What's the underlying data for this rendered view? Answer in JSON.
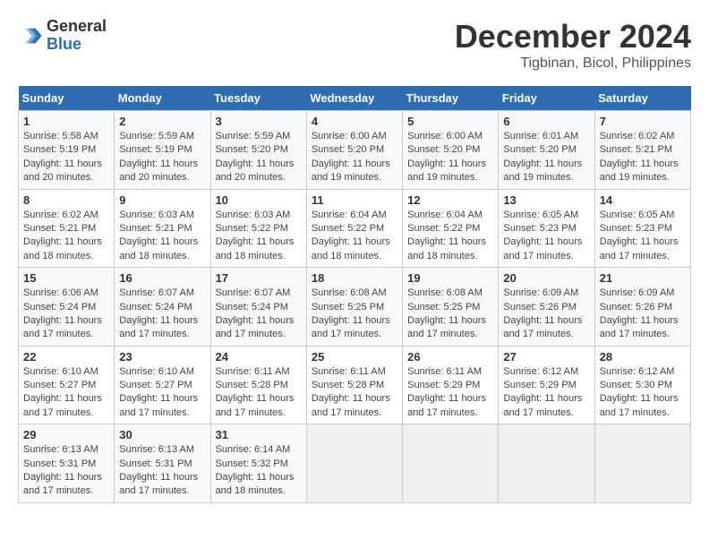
{
  "header": {
    "logo_general": "General",
    "logo_blue": "Blue",
    "title": "December 2024",
    "subtitle": "Tigbinan, Bicol, Philippines"
  },
  "calendar": {
    "days_of_week": [
      "Sunday",
      "Monday",
      "Tuesday",
      "Wednesday",
      "Thursday",
      "Friday",
      "Saturday"
    ],
    "weeks": [
      [
        {
          "day": "1",
          "sunrise": "5:58 AM",
          "sunset": "5:19 PM",
          "daylight": "11 hours and 20 minutes."
        },
        {
          "day": "2",
          "sunrise": "5:59 AM",
          "sunset": "5:19 PM",
          "daylight": "11 hours and 20 minutes."
        },
        {
          "day": "3",
          "sunrise": "5:59 AM",
          "sunset": "5:20 PM",
          "daylight": "11 hours and 20 minutes."
        },
        {
          "day": "4",
          "sunrise": "6:00 AM",
          "sunset": "5:20 PM",
          "daylight": "11 hours and 19 minutes."
        },
        {
          "day": "5",
          "sunrise": "6:00 AM",
          "sunset": "5:20 PM",
          "daylight": "11 hours and 19 minutes."
        },
        {
          "day": "6",
          "sunrise": "6:01 AM",
          "sunset": "5:20 PM",
          "daylight": "11 hours and 19 minutes."
        },
        {
          "day": "7",
          "sunrise": "6:02 AM",
          "sunset": "5:21 PM",
          "daylight": "11 hours and 19 minutes."
        }
      ],
      [
        {
          "day": "8",
          "sunrise": "6:02 AM",
          "sunset": "5:21 PM",
          "daylight": "11 hours and 18 minutes."
        },
        {
          "day": "9",
          "sunrise": "6:03 AM",
          "sunset": "5:21 PM",
          "daylight": "11 hours and 18 minutes."
        },
        {
          "day": "10",
          "sunrise": "6:03 AM",
          "sunset": "5:22 PM",
          "daylight": "11 hours and 18 minutes."
        },
        {
          "day": "11",
          "sunrise": "6:04 AM",
          "sunset": "5:22 PM",
          "daylight": "11 hours and 18 minutes."
        },
        {
          "day": "12",
          "sunrise": "6:04 AM",
          "sunset": "5:22 PM",
          "daylight": "11 hours and 18 minutes."
        },
        {
          "day": "13",
          "sunrise": "6:05 AM",
          "sunset": "5:23 PM",
          "daylight": "11 hours and 17 minutes."
        },
        {
          "day": "14",
          "sunrise": "6:05 AM",
          "sunset": "5:23 PM",
          "daylight": "11 hours and 17 minutes."
        }
      ],
      [
        {
          "day": "15",
          "sunrise": "6:06 AM",
          "sunset": "5:24 PM",
          "daylight": "11 hours and 17 minutes."
        },
        {
          "day": "16",
          "sunrise": "6:07 AM",
          "sunset": "5:24 PM",
          "daylight": "11 hours and 17 minutes."
        },
        {
          "day": "17",
          "sunrise": "6:07 AM",
          "sunset": "5:24 PM",
          "daylight": "11 hours and 17 minutes."
        },
        {
          "day": "18",
          "sunrise": "6:08 AM",
          "sunset": "5:25 PM",
          "daylight": "11 hours and 17 minutes."
        },
        {
          "day": "19",
          "sunrise": "6:08 AM",
          "sunset": "5:25 PM",
          "daylight": "11 hours and 17 minutes."
        },
        {
          "day": "20",
          "sunrise": "6:09 AM",
          "sunset": "5:26 PM",
          "daylight": "11 hours and 17 minutes."
        },
        {
          "day": "21",
          "sunrise": "6:09 AM",
          "sunset": "5:26 PM",
          "daylight": "11 hours and 17 minutes."
        }
      ],
      [
        {
          "day": "22",
          "sunrise": "6:10 AM",
          "sunset": "5:27 PM",
          "daylight": "11 hours and 17 minutes."
        },
        {
          "day": "23",
          "sunrise": "6:10 AM",
          "sunset": "5:27 PM",
          "daylight": "11 hours and 17 minutes."
        },
        {
          "day": "24",
          "sunrise": "6:11 AM",
          "sunset": "5:28 PM",
          "daylight": "11 hours and 17 minutes."
        },
        {
          "day": "25",
          "sunrise": "6:11 AM",
          "sunset": "5:28 PM",
          "daylight": "11 hours and 17 minutes."
        },
        {
          "day": "26",
          "sunrise": "6:11 AM",
          "sunset": "5:29 PM",
          "daylight": "11 hours and 17 minutes."
        },
        {
          "day": "27",
          "sunrise": "6:12 AM",
          "sunset": "5:29 PM",
          "daylight": "11 hours and 17 minutes."
        },
        {
          "day": "28",
          "sunrise": "6:12 AM",
          "sunset": "5:30 PM",
          "daylight": "11 hours and 17 minutes."
        }
      ],
      [
        {
          "day": "29",
          "sunrise": "6:13 AM",
          "sunset": "5:31 PM",
          "daylight": "11 hours and 17 minutes."
        },
        {
          "day": "30",
          "sunrise": "6:13 AM",
          "sunset": "5:31 PM",
          "daylight": "11 hours and 17 minutes."
        },
        {
          "day": "31",
          "sunrise": "6:14 AM",
          "sunset": "5:32 PM",
          "daylight": "11 hours and 18 minutes."
        },
        null,
        null,
        null,
        null
      ]
    ]
  }
}
